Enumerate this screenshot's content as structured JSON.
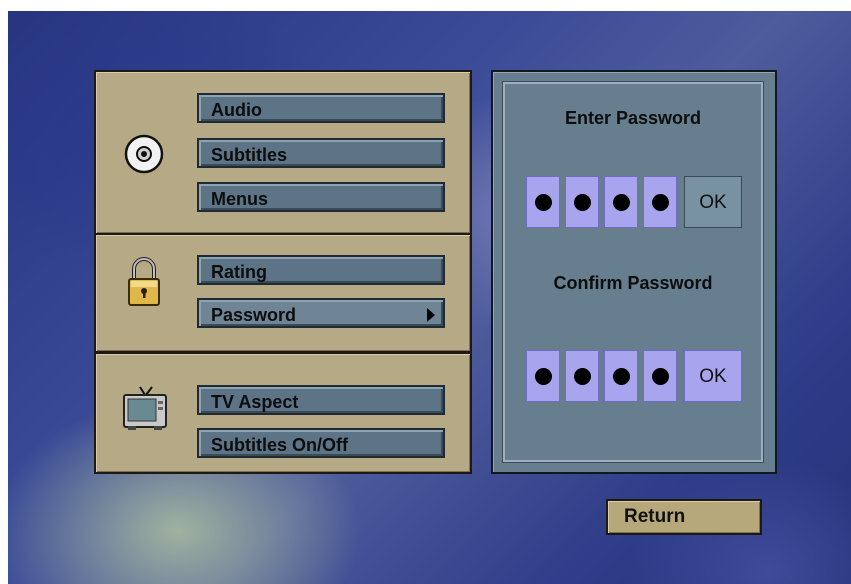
{
  "menu": {
    "disc_group": {
      "icon": "disc-icon",
      "items": [
        {
          "label": "Audio"
        },
        {
          "label": "Subtitles"
        },
        {
          "label": "Menus"
        }
      ]
    },
    "parental_group": {
      "icon": "padlock-icon",
      "items": [
        {
          "label": "Rating"
        },
        {
          "label": "Password",
          "selected": true,
          "has_submenu": true
        }
      ]
    },
    "display_group": {
      "icon": "tv-icon",
      "items": [
        {
          "label": "TV Aspect"
        },
        {
          "label": "Subtitles On/Off"
        }
      ]
    }
  },
  "password_panel": {
    "enter_title": "Enter Password",
    "enter_ok": "OK",
    "enter_digits_filled": 4,
    "confirm_title": "Confirm Password",
    "confirm_ok": "OK",
    "confirm_digits_filled": 4
  },
  "return_label": "Return",
  "colors": {
    "panel": "#b6a985",
    "button": "#5d7486",
    "password_panel": "#667e8d",
    "digit_box": "#a9a4ee",
    "enter_ok_box": "#7892a2",
    "confirm_ok_box": "#a9a4ee"
  }
}
